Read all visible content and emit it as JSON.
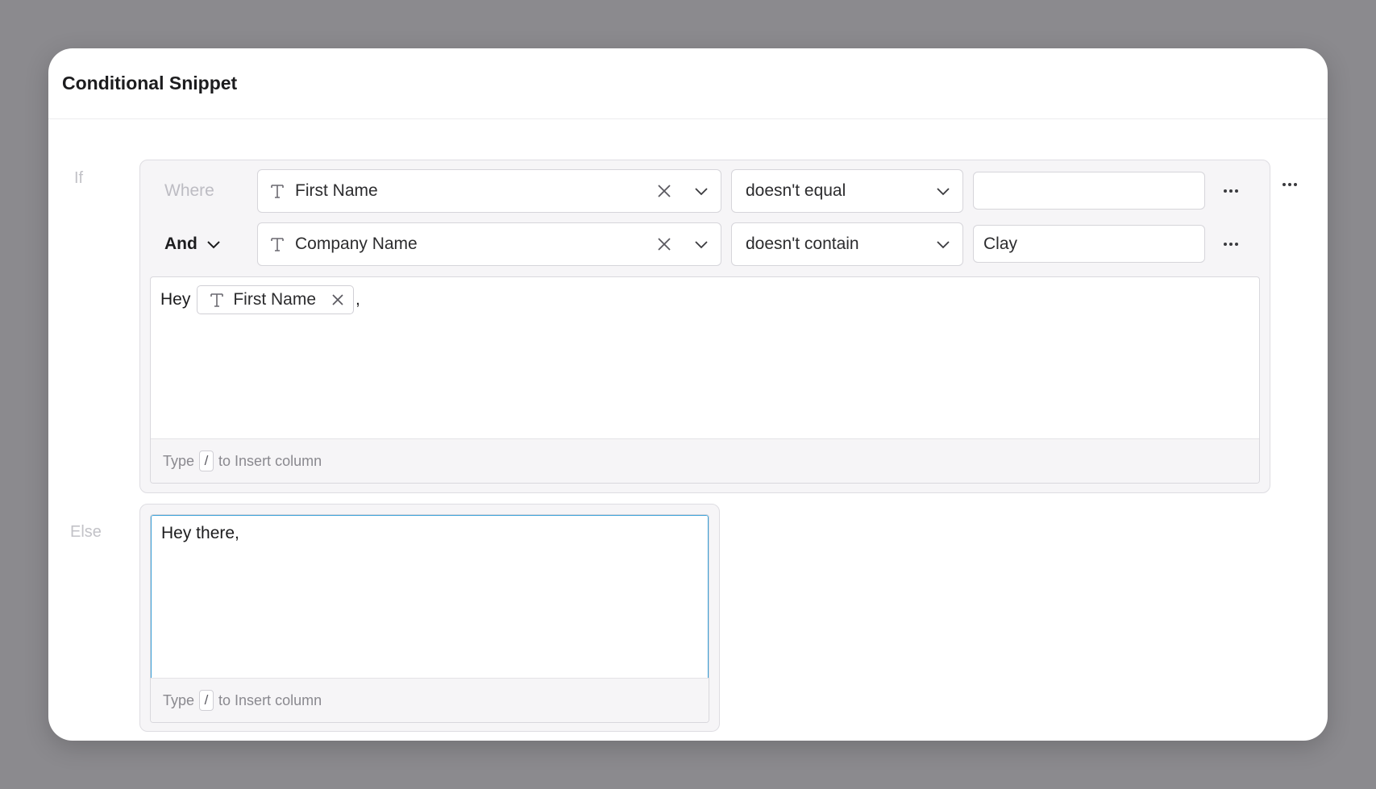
{
  "modal": {
    "title": "Conditional Snippet"
  },
  "labels": {
    "if": "If",
    "else": "Else"
  },
  "conditions": [
    {
      "connector": "Where",
      "field": "First Name",
      "operator": "doesn't equal",
      "value": ""
    },
    {
      "connector": "And",
      "field": "Company Name",
      "operator": "doesn't contain",
      "value": "Clay"
    }
  ],
  "if_editor": {
    "prefix": "Hey",
    "chip_label": "First Name",
    "suffix": ",",
    "hint_before": "Type",
    "hint_key": "/",
    "hint_after": "to Insert column"
  },
  "else_editor": {
    "text": "Hey there,",
    "hint_before": "Type",
    "hint_key": "/",
    "hint_after": "to Insert column"
  },
  "icons": {
    "field_type": "text-type-icon",
    "clear": "close-icon",
    "dropdown": "chevron-down-icon",
    "more": "more-horizontal-icon"
  },
  "colors": {
    "backdrop": "#8b8a8e",
    "panel": "#f6f5f7",
    "focus_border": "#3aa0d8",
    "muted_text": "#c2c2c7"
  }
}
